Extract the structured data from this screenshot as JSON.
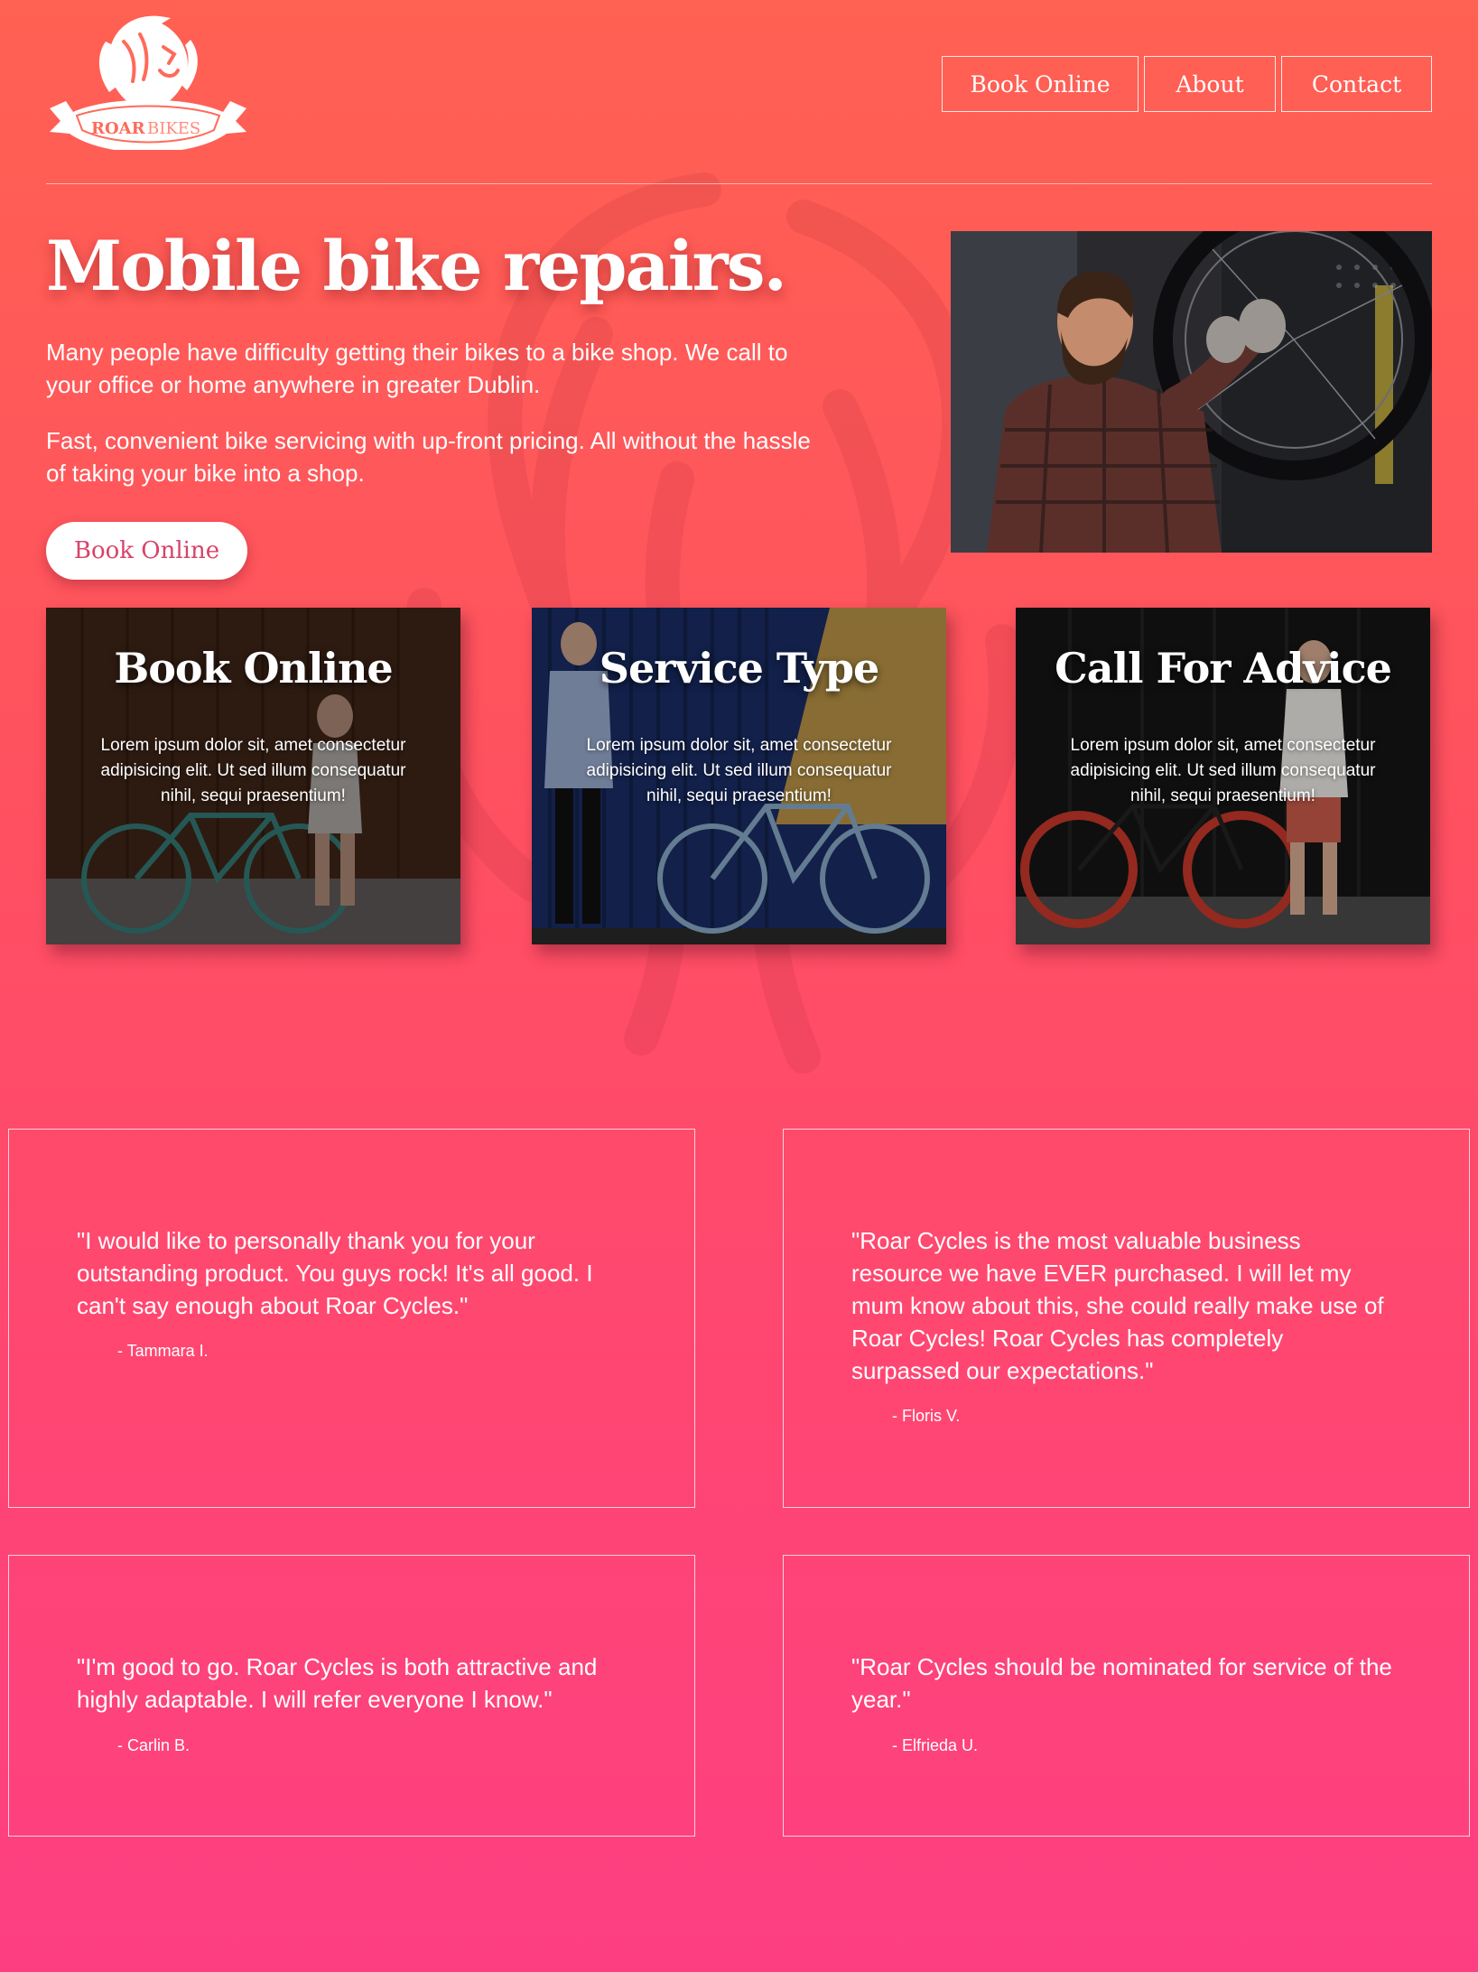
{
  "brand": {
    "logo_text_1": "ROAR",
    "logo_text_2": "BIKES"
  },
  "nav": {
    "items": [
      "Book Online",
      "About",
      "Contact"
    ]
  },
  "hero": {
    "title": "Mobile bike repairs.",
    "paragraph_1": "Many people have difficulty getting their bikes to a bike shop. We call to your office or home anywhere in greater Dublin.",
    "paragraph_2": "Fast, convenient bike servicing with up-front pricing. All without the hassle of taking your bike into a shop.",
    "cta_label": "Book Online"
  },
  "cards": [
    {
      "title": "Book Online",
      "text": "Lorem ipsum dolor sit, amet consectetur adipisicing elit. Ut sed illum consequatur nihil, sequi praesentium!"
    },
    {
      "title": "Service Type",
      "text": "Lorem ipsum dolor sit, amet consectetur adipisicing elit. Ut sed illum consequatur nihil, sequi praesentium!"
    },
    {
      "title": "Call For Advice",
      "text": "Lorem ipsum dolor sit, amet consectetur adipisicing elit. Ut sed illum consequatur nihil, sequi praesentium!"
    }
  ],
  "testimonials": [
    {
      "quote": "\"I would like to personally thank you for your outstanding product. You guys rock! It's all good. I can't say enough about Roar Cycles.\"",
      "author": "- Tammara I."
    },
    {
      "quote": "\"Roar Cycles is the most valuable business resource we have EVER purchased. I will let my mum know about this, she could really make use of Roar Cycles! Roar Cycles has completely surpassed our expectations.\"",
      "author": "- Floris V."
    },
    {
      "quote": "\"I'm good to go. Roar Cycles is both attractive and highly adaptable. I will refer everyone I know.\"",
      "author": "- Carlin B."
    },
    {
      "quote": "\"Roar Cycles should be nominated for service of the year.\"",
      "author": "- Elfrieda U."
    }
  ],
  "colors": {
    "gradient_top": "#ff6152",
    "gradient_bottom": "#fd3f82",
    "cta_text": "#d8436a"
  }
}
